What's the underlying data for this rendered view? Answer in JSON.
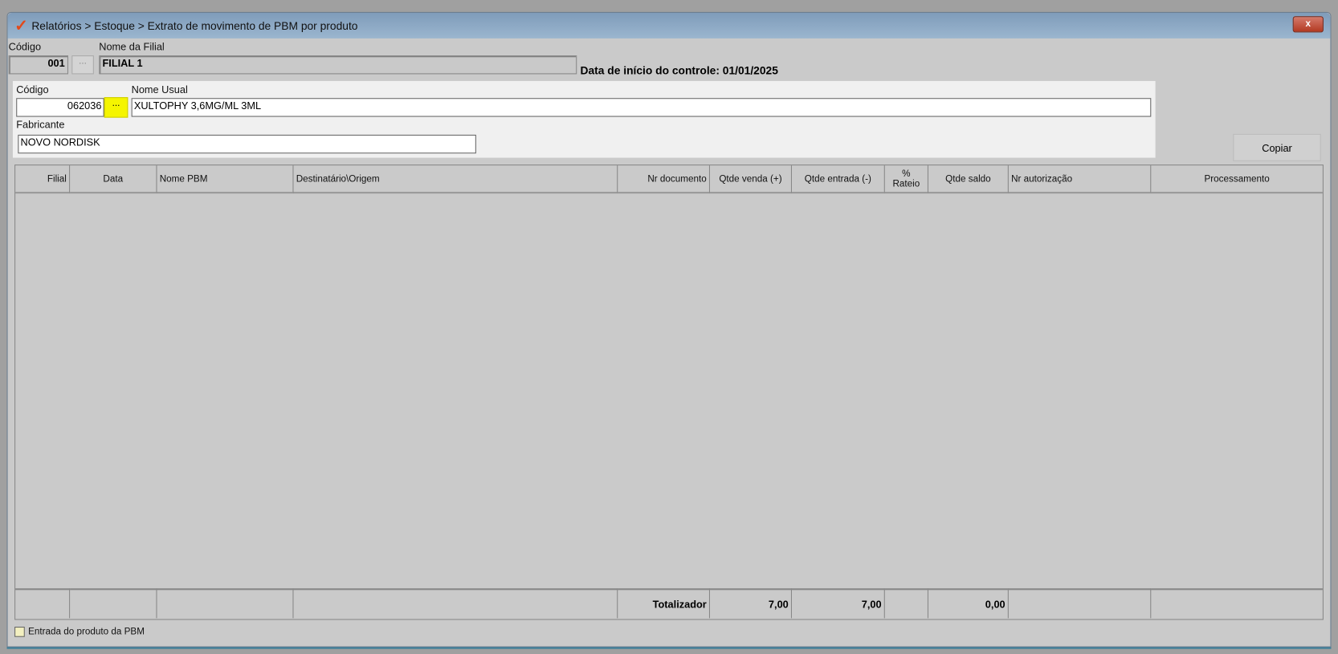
{
  "window": {
    "title": "Relatórios > Estoque > Extrato de movimento de PBM por produto",
    "close_label": "x"
  },
  "filial": {
    "codigo_label": "Código",
    "codigo_value": "001",
    "lookup_label": "...",
    "nome_label": "Nome da Filial",
    "nome_value": "FILIAL 1"
  },
  "controle": {
    "text": "Data de início do controle: 01/01/2025"
  },
  "produto": {
    "codigo_label": "Código",
    "codigo_value": "062036",
    "lookup_label": "...",
    "nome_label": "Nome Usual",
    "nome_value": "XULTOPHY 3,6MG/ML 3ML",
    "fabricante_label": "Fabricante",
    "fabricante_value": "NOVO NORDISK"
  },
  "copiar_label": "Copiar",
  "grid": {
    "columns": [
      "Filial",
      "Data",
      "Nome PBM",
      "Destinatário\\Origem",
      "Nr documento",
      "Qtde venda (+)",
      "Qtde entrada (-)",
      "% Rateio",
      "Qtde saldo",
      "Nr autorização",
      "Processamento"
    ],
    "footer": [
      "",
      "",
      "",
      "",
      "Totalizador",
      "7,00",
      "7,00",
      "",
      "0,00",
      "",
      ""
    ]
  },
  "checkbox": {
    "label": "Entrada do produto da PBM",
    "checked": false
  }
}
